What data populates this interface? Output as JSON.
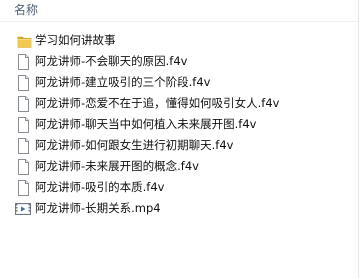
{
  "header": {
    "name_column": "名称"
  },
  "files": [
    {
      "name": "学习如何讲故事",
      "icon": "folder-icon",
      "kind": "folder"
    },
    {
      "name": "阿龙讲师-不会聊天的原因.f4v",
      "icon": "file-icon",
      "kind": "file"
    },
    {
      "name": "阿龙讲师-建立吸引的三个阶段.f4v",
      "icon": "file-icon",
      "kind": "file"
    },
    {
      "name": "阿龙讲师-恋爱不在于追，懂得如何吸引女人.f4v",
      "icon": "file-icon",
      "kind": "file"
    },
    {
      "name": "阿龙讲师-聊天当中如何植入未来展开图.f4v",
      "icon": "file-icon",
      "kind": "file"
    },
    {
      "name": "阿龙讲师-如何跟女生进行初期聊天.f4v",
      "icon": "file-icon",
      "kind": "file"
    },
    {
      "name": "阿龙讲师-未来展开图的概念.f4v",
      "icon": "file-icon",
      "kind": "file"
    },
    {
      "name": "阿龙讲师-吸引的本质.f4v",
      "icon": "file-icon",
      "kind": "file"
    },
    {
      "name": "阿龙讲师-长期关系.mp4",
      "icon": "mp4-video-icon",
      "kind": "video"
    }
  ],
  "colors": {
    "header_text": "#4c607a",
    "folder": "#e8b93c",
    "file_text": "#111111"
  }
}
